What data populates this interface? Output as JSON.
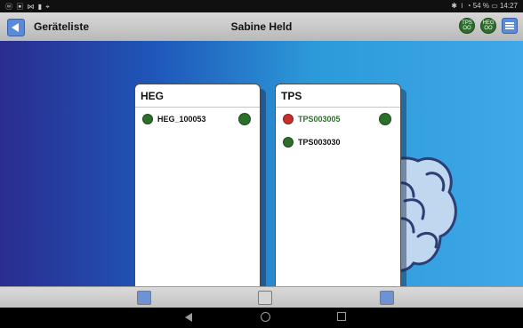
{
  "statusbar": {
    "left": "ⓦ ▣ ⋈ ▮ ⌖",
    "right": "✱ ⏽ ◔ 54 % ▭ 14:27"
  },
  "appbar": {
    "title": "Geräteliste",
    "center_title": "Sabine Held",
    "badges": [
      "TPS OO",
      "HEG OO"
    ]
  },
  "panels": {
    "heg": {
      "title": "HEG",
      "devices": [
        {
          "name": "HEG_100053",
          "icon": "heg-device-icon",
          "status_badge": "green"
        }
      ]
    },
    "tps": {
      "title": "TPS",
      "devices": [
        {
          "name": "TPS003005",
          "icon": "tps-device-icon-red",
          "status_badge": "green",
          "name_color": "#2b6f2a"
        },
        {
          "name": "TPS003030",
          "icon": "tps-device-icon",
          "status_badge": ""
        }
      ]
    }
  },
  "colors": {
    "accent_blue": "#5b8bd8",
    "device_green": "#2b6f2a",
    "device_red": "#c52f2c"
  }
}
